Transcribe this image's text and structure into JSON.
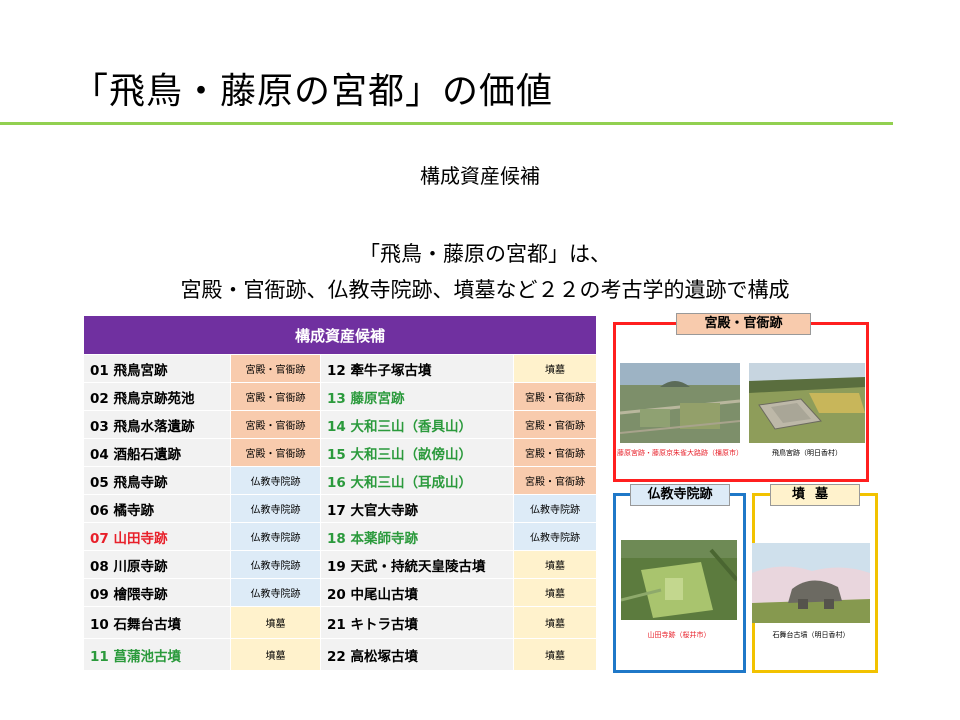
{
  "title": "「飛鳥・藤原の宮都」の価値",
  "subtitle": "構成資産候補",
  "description": {
    "line1": "「飛鳥・藤原の宮都」は、",
    "line2": "宮殿・官衙跡、仏教寺院跡、墳墓など２２の考古学的遺跡で構成"
  },
  "table": {
    "header": "構成資産候補",
    "rows": [
      {
        "left": {
          "name": "01 飛鳥宮跡",
          "cat": "宮殿・官衙跡",
          "type": "palace",
          "color": "default"
        },
        "right": {
          "name": "12 牽牛子塚古墳",
          "cat": "墳墓",
          "type": "tomb",
          "color": "default"
        }
      },
      {
        "left": {
          "name": "02 飛鳥京跡苑池",
          "cat": "宮殿・官衙跡",
          "type": "palace",
          "color": "default"
        },
        "right": {
          "name": "13 藤原宮跡",
          "cat": "宮殿・官衙跡",
          "type": "palace",
          "color": "green"
        }
      },
      {
        "left": {
          "name": "03 飛鳥水落遺跡",
          "cat": "宮殿・官衙跡",
          "type": "palace",
          "color": "default"
        },
        "right": {
          "name": "14 大和三山（香具山）",
          "cat": "宮殿・官衙跡",
          "type": "palace",
          "color": "green"
        }
      },
      {
        "left": {
          "name": "04 酒船石遺跡",
          "cat": "宮殿・官衙跡",
          "type": "palace",
          "color": "default"
        },
        "right": {
          "name": "15 大和三山（畝傍山）",
          "cat": "宮殿・官衙跡",
          "type": "palace",
          "color": "green"
        }
      },
      {
        "left": {
          "name": "05 飛鳥寺跡",
          "cat": "仏教寺院跡",
          "type": "temple",
          "color": "default"
        },
        "right": {
          "name": "16 大和三山（耳成山）",
          "cat": "宮殿・官衙跡",
          "type": "palace",
          "color": "green"
        }
      },
      {
        "left": {
          "name": "06 橘寺跡",
          "cat": "仏教寺院跡",
          "type": "temple",
          "color": "default"
        },
        "right": {
          "name": "17 大官大寺跡",
          "cat": "仏教寺院跡",
          "type": "temple",
          "color": "default"
        }
      },
      {
        "left": {
          "name": "07 山田寺跡",
          "cat": "仏教寺院跡",
          "type": "temple",
          "color": "red"
        },
        "right": {
          "name": "18 本薬師寺跡",
          "cat": "仏教寺院跡",
          "type": "temple",
          "color": "green"
        }
      },
      {
        "left": {
          "name": "08 川原寺跡",
          "cat": "仏教寺院跡",
          "type": "temple",
          "color": "default"
        },
        "right": {
          "name": "19 天武・持統天皇陵古墳",
          "cat": "墳墓",
          "type": "tomb",
          "color": "default"
        }
      },
      {
        "left": {
          "name": "09 檜隈寺跡",
          "cat": "仏教寺院跡",
          "type": "temple",
          "color": "default"
        },
        "right": {
          "name": "20 中尾山古墳",
          "cat": "墳墓",
          "type": "tomb",
          "color": "default"
        }
      },
      {
        "left": {
          "name": "10 石舞台古墳",
          "cat": "墳墓",
          "type": "tomb",
          "color": "default"
        },
        "right": {
          "name": "21 キトラ古墳",
          "cat": "墳墓",
          "type": "tomb",
          "color": "default"
        }
      },
      {
        "left": {
          "name": "11 菖蒲池古墳",
          "cat": "墳墓",
          "type": "tomb",
          "color": "green"
        },
        "right": {
          "name": "22 高松塚古墳",
          "cat": "墳墓",
          "type": "tomb",
          "color": "default"
        }
      }
    ]
  },
  "categories": {
    "palace": {
      "label": "宮殿・官衙跡",
      "color": "#ff1f1f"
    },
    "temple": {
      "label": "仏教寺院跡",
      "color": "#1f78c8"
    },
    "tomb": {
      "label": "墳墓",
      "color": "#f2c200"
    }
  },
  "photos": {
    "fujiwara": {
      "caption": "藤原宮跡・藤原京朱雀大路跡（橿原市）"
    },
    "asukakyo": {
      "caption": "飛鳥宮跡（明日香村）"
    },
    "yamadadera": {
      "caption": "山田寺跡（桜井市）"
    },
    "ishibutai": {
      "caption": "石舞台古墳（明日香村）"
    }
  }
}
